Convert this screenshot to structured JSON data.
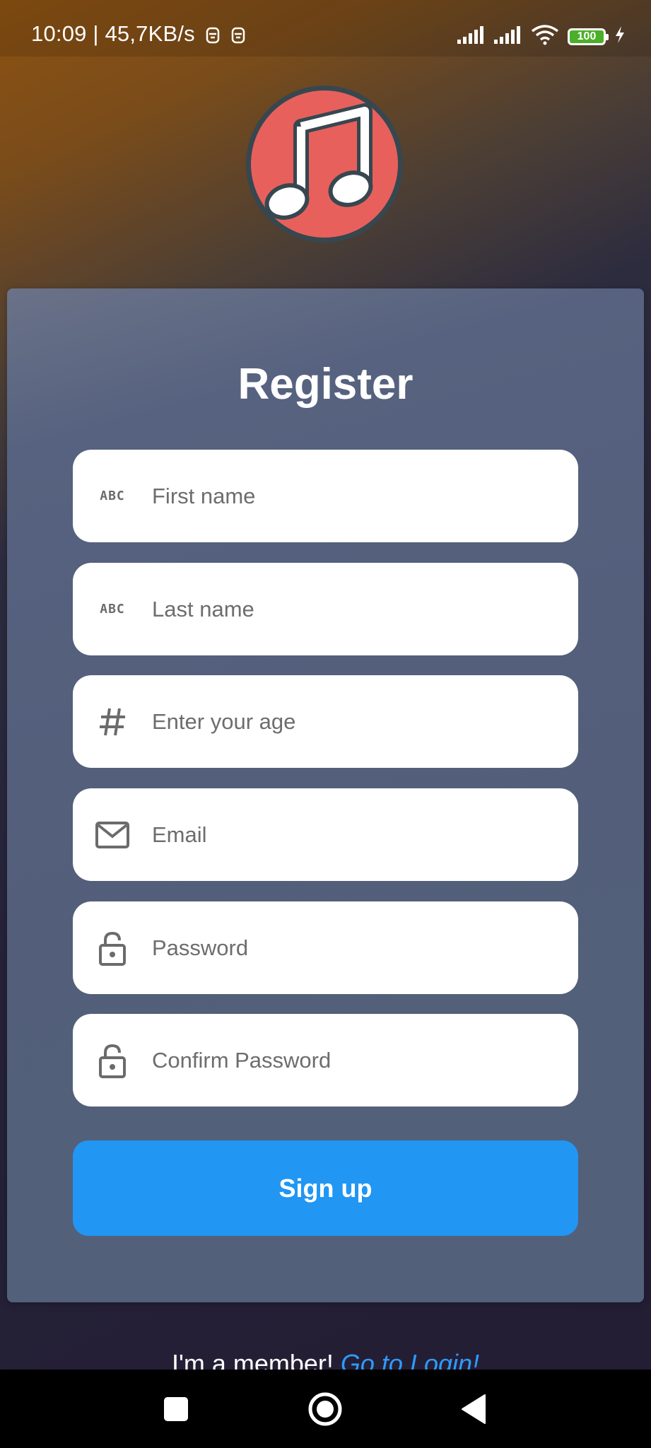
{
  "status_bar": {
    "time_speed": "10:09 | 45,7KB/s",
    "battery_level": "100",
    "icons": [
      "notification-icon",
      "notification-icon",
      "signal-icon",
      "signal-icon",
      "wifi-icon",
      "battery-icon",
      "charging-icon"
    ]
  },
  "app": {
    "logo_icon": "music-note-icon",
    "logo_color": "#e8605c"
  },
  "form": {
    "title": "Register",
    "abc_icon_text": "ABC",
    "fields": {
      "first_name": {
        "placeholder": "First name",
        "icon": "abc-icon"
      },
      "last_name": {
        "placeholder": "Last name",
        "icon": "abc-icon"
      },
      "age": {
        "placeholder": "Enter your age",
        "icon": "hash-icon"
      },
      "email": {
        "placeholder": "Email",
        "icon": "mail-icon"
      },
      "password": {
        "placeholder": "Password",
        "icon": "lock-icon"
      },
      "confirm_password": {
        "placeholder": "Confirm Password",
        "icon": "lock-icon"
      }
    },
    "signup_label": "Sign up",
    "accent_color": "#2196f3"
  },
  "footer": {
    "member_text": "I'm a member!",
    "login_link": "Go to Login!"
  },
  "nav_bar": {
    "buttons": [
      "recents-button",
      "home-button",
      "back-button"
    ]
  }
}
